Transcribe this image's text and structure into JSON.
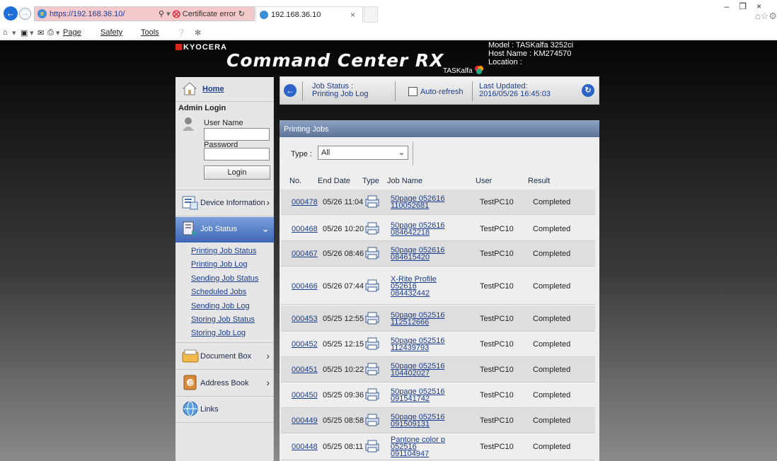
{
  "browser": {
    "url": "https://192.168.36.10/",
    "cert_error": "Certificate error",
    "tab_title": "192.168.36.10",
    "menu": {
      "page": "Page",
      "safety": "Safety",
      "tools": "Tools"
    }
  },
  "header": {
    "logo": "KYOCERA",
    "title": "Command Center RX",
    "brand": "TASKalfa",
    "model": "Model : TASKalfa 3252ci",
    "host": "Host Name : KM274570",
    "location": "Location :"
  },
  "sidebar": {
    "home": "Home",
    "admin_login": "Admin Login",
    "user_name_label": "User Name",
    "user_name_value": "",
    "password_label": "Password",
    "password_value": "",
    "login_button": "Login",
    "nav": {
      "device_information": "Device Information",
      "job_status": "Job Status",
      "document_box": "Document Box",
      "address_book": "Address Book",
      "links": "Links"
    },
    "job_status_sub": [
      "Printing Job Status",
      "Printing Job Log",
      "Sending Job Status",
      "Scheduled Jobs",
      "Sending Job Log",
      "Storing Job Status",
      "Storing Job Log"
    ]
  },
  "topbar": {
    "job_status_line1": "Job Status :",
    "job_status_line2": "Printing Job Log",
    "auto_refresh": "Auto-refresh",
    "last_updated_label": "Last Updated:",
    "last_updated_value": "2016/05/26 16:45:03"
  },
  "panel": {
    "title": "Printing Jobs",
    "type_label": "Type :",
    "type_value": "All",
    "columns": [
      "No.",
      "End Date",
      "Type",
      "Job Name",
      "User",
      "Result"
    ],
    "rows": [
      {
        "no": "000478",
        "date": "05/26 11:04",
        "name": [
          "50page 052616",
          "110052681"
        ],
        "user": "TestPC10",
        "result": "Completed"
      },
      {
        "no": "000468",
        "date": "05/26 10:20",
        "name": [
          "50page 052616",
          "084642218"
        ],
        "user": "TestPC10",
        "result": "Completed"
      },
      {
        "no": "000467",
        "date": "05/26 08:46",
        "name": [
          "50page 052616",
          "084615420"
        ],
        "user": "TestPC10",
        "result": "Completed"
      },
      {
        "no": "000466",
        "date": "05/26 07:44",
        "name": [
          "X-Rite Profile",
          "052616",
          "084432442"
        ],
        "user": "TestPC10",
        "result": "Completed"
      },
      {
        "no": "000453",
        "date": "05/25 12:55",
        "name": [
          "50page 052516",
          "112512666"
        ],
        "user": "TestPC10",
        "result": "Completed"
      },
      {
        "no": "000452",
        "date": "05/25 12:15",
        "name": [
          "50page 052516",
          "112439793"
        ],
        "user": "TestPC10",
        "result": "Completed"
      },
      {
        "no": "000451",
        "date": "05/25 10:22",
        "name": [
          "50page 052516",
          "104402027"
        ],
        "user": "TestPC10",
        "result": "Completed"
      },
      {
        "no": "000450",
        "date": "05/25 09:36",
        "name": [
          "50page 052516",
          "091541742"
        ],
        "user": "TestPC10",
        "result": "Completed"
      },
      {
        "no": "000449",
        "date": "05/25 08:58",
        "name": [
          "50page 052516",
          "091509131"
        ],
        "user": "TestPC10",
        "result": "Completed"
      },
      {
        "no": "000448",
        "date": "05/25 08:11",
        "name": [
          "Pantone color p",
          "052516",
          "091104947"
        ],
        "user": "TestPC10",
        "result": "Completed"
      }
    ]
  }
}
